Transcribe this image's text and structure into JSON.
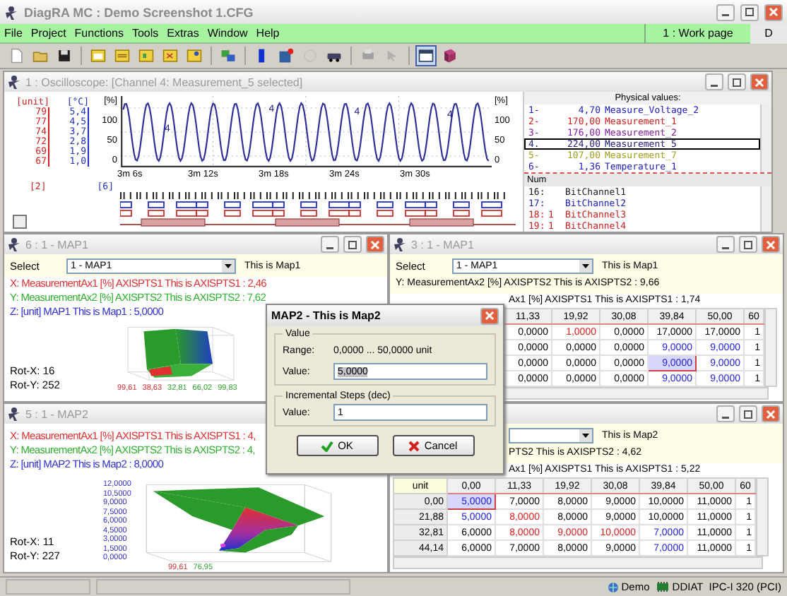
{
  "window": {
    "title": "DiagRA MC : Demo Screenshot 1.CFG"
  },
  "menu": [
    "File",
    "Project",
    "Functions",
    "Tools",
    "Extras",
    "Window",
    "Help"
  ],
  "work_page": "1 : Work page",
  "menu_right": "D",
  "oscilloscope": {
    "title": "1 : Oscilloscope: [Channel 4: Measurement_5 selected]",
    "axes": [
      {
        "unit": "[unit]",
        "ticks": [
          "79",
          "77",
          "74",
          "72",
          "69",
          "67"
        ],
        "index": "[2]",
        "color": "#d02020"
      },
      {
        "unit": "[°C]",
        "ticks": [
          "5,4",
          "4,5",
          "3,7",
          "2,8",
          "1,9",
          "1,0"
        ],
        "index": "[6]",
        "color": "#2030c0"
      }
    ],
    "left_percent": {
      "unit": "[%]",
      "ticks": [
        "100",
        "50",
        "0"
      ]
    },
    "right_percent": {
      "unit": "[%]",
      "ticks": [
        "100",
        "50",
        "0"
      ]
    },
    "wave_markers": [
      "4",
      "4",
      "4",
      "4"
    ],
    "time_ticks": [
      "3m 6s",
      "3m 12s",
      "3m 18s",
      "3m 24s",
      "3m 30s"
    ],
    "physical_header": "Physical values:",
    "physical_values": [
      {
        "num": "1-",
        "value": "4,70",
        "name": "Measure_Voltage_2",
        "color": "#2020c0",
        "selected": false
      },
      {
        "num": "2-",
        "value": "170,00",
        "name": "Measurement_1",
        "color": "#d02020",
        "selected": false
      },
      {
        "num": "3-",
        "value": "176,00",
        "name": "Measurement_2",
        "color": "#8020a0",
        "selected": false
      },
      {
        "num": "4.",
        "value": "224,00",
        "name": "Measurement_5",
        "color": "#202080",
        "selected": true
      },
      {
        "num": "5-",
        "value": "107,00",
        "name": "Measurement_7",
        "color": "#a0a020",
        "selected": false
      },
      {
        "num": "6-",
        "value": "1,36",
        "name": "Temperature_1",
        "color": "#2020c0",
        "selected": false
      }
    ],
    "num_header": "Num",
    "bit_channels": [
      {
        "num": "16:",
        "name": "BitChannel1",
        "color": "#202020"
      },
      {
        "num": "17:",
        "name": "BitChannel2",
        "color": "#2020c0"
      },
      {
        "num": "18:",
        "state": "1",
        "name": "BitChannel3",
        "color": "#d02020"
      },
      {
        "num": "19:",
        "state": "1",
        "name": "BitChannel4",
        "color": "#d02020"
      }
    ]
  },
  "map_views": [
    {
      "title": "6 : 1 - MAP1",
      "select": {
        "label": "Select",
        "value": "1 - MAP1",
        "description": "This is Map1"
      },
      "lines": [
        {
          "text": "X: MeasurementAx1 [%] AXISPTS1 This is AXISPTS1 : 2,46",
          "color": "#e03030"
        },
        {
          "text": "Y: MeasurementAx2 [%] AXISPTS2 This is AXISPTS2 : 7,62",
          "color": "#30b030"
        },
        {
          "text": "Z: [unit] MAP1 This is Map1 : 5,0000",
          "color": "#3030d0"
        }
      ],
      "kind": "steep",
      "x_labels": [
        "99,61",
        "38,63",
        "32,81",
        "66,02",
        "99,83"
      ],
      "rotation": [
        "Rot-X: 16",
        "Rot-Y: 252"
      ]
    },
    {
      "title": "5 : 1 - MAP2",
      "lines": [
        {
          "text": "X: MeasurementAx1 [%] AXISPTS1 This is AXISPTS1 : 4,",
          "color": "#e03030"
        },
        {
          "text": "Y: MeasurementAx2 [%] AXISPTS2 This is AXISPTS2 : 4,",
          "color": "#30b030"
        },
        {
          "text": "Z: [unit] MAP2 This is Map2 : 8,0000",
          "color": "#3030d0"
        }
      ],
      "kind": "slope",
      "z_labels": [
        "12,0000",
        "10,5000",
        "9,0000",
        "7,5000",
        "6,0000",
        "4,5000",
        "3,0000",
        "1,5000",
        "0,0000"
      ],
      "x_labels": [
        "99,61",
        "76,95"
      ],
      "rotation": [
        "Rot-X: 11",
        "Rot-Y: 227"
      ]
    }
  ],
  "map_tables": [
    {
      "title": "3 : 1 - MAP1",
      "select": {
        "label": "Select",
        "value": "1 - MAP1",
        "description": "This is Map1"
      },
      "lines": [
        "Y: MeasurementAx2 [%] AXISPTS2 This is AXISPTS2 : 9,66"
      ],
      "x_label": "Ax1 [%] AXISPTS1 This is AXISPTS1 : 1,74",
      "columns": [
        "11,33",
        "19,92",
        "30,08",
        "39,84",
        "50,00",
        "60"
      ],
      "rows": [
        {
          "cells": [
            {
              "t": "0,0000",
              "selected": false
            },
            {
              "t": "1,0000",
              "color": "#e02020",
              "selected": false
            },
            {
              "t": "0,0000",
              "selected": false
            },
            {
              "t": "17,0000",
              "selected": false
            },
            {
              "t": "17,0000",
              "selected": false
            },
            {
              "t": "1",
              "selected": false
            }
          ]
        },
        {
          "cells": [
            {
              "t": "0,0000",
              "selected": false
            },
            {
              "t": "0,0000",
              "selected": false
            },
            {
              "t": "0,0000",
              "selected": false
            },
            {
              "t": "9,0000",
              "color": "#2020e0",
              "selected": false
            },
            {
              "t": "9,0000",
              "color": "#2020e0",
              "selected": false
            },
            {
              "t": "1",
              "selected": false
            }
          ]
        },
        {
          "cells": [
            {
              "t": "0,0000",
              "selected": false
            },
            {
              "t": "0,0000",
              "selected": false
            },
            {
              "t": "0,0000",
              "selected": false
            },
            {
              "t": "9,0000",
              "color": "#2020e0",
              "selected": true
            },
            {
              "t": "9,0000",
              "color": "#2020e0",
              "selected": false
            },
            {
              "t": "1",
              "selected": false
            }
          ]
        },
        {
          "cells": [
            {
              "t": "0,0000",
              "selected": false
            },
            {
              "t": "0,0000",
              "selected": false
            },
            {
              "t": "0,0000",
              "selected": false
            },
            {
              "t": "9,0000",
              "color": "#2020e0",
              "selected": false
            },
            {
              "t": "9,0000",
              "color": "#2020e0",
              "selected": false
            },
            {
              "t": "1",
              "selected": false
            }
          ]
        }
      ]
    },
    {
      "select": {
        "description": "This is Map2"
      },
      "lines": [
        "PTS2 This is AXISPTS2 : 4,62"
      ],
      "x_label": "Ax1 [%] AXISPTS1 This is AXISPTS1 : 5,22",
      "corner": "unit",
      "columns": [
        "0,00",
        "11,33",
        "19,92",
        "30,08",
        "39,84",
        "50,00",
        "60"
      ],
      "rows": [
        {
          "header": "0,00",
          "cells": [
            {
              "t": "5,0000",
              "color": "#2020e0",
              "selected": true
            },
            {
              "t": "7,0000",
              "selected": false
            },
            {
              "t": "8,0000",
              "selected": false
            },
            {
              "t": "9,0000",
              "selected": false
            },
            {
              "t": "10,0000",
              "selected": false
            },
            {
              "t": "11,0000",
              "selected": false
            },
            {
              "t": "1",
              "selected": false
            }
          ]
        },
        {
          "header": "21,88",
          "cells": [
            {
              "t": "5,0000",
              "color": "#2020e0",
              "selected": false
            },
            {
              "t": "8,0000",
              "color": "#e02020",
              "selected": false
            },
            {
              "t": "8,0000",
              "selected": false
            },
            {
              "t": "9,0000",
              "selected": false
            },
            {
              "t": "10,0000",
              "selected": false
            },
            {
              "t": "11,0000",
              "selected": false
            },
            {
              "t": "1",
              "selected": false
            }
          ]
        },
        {
          "header": "32,81",
          "cells": [
            {
              "t": "6,0000",
              "selected": false
            },
            {
              "t": "8,0000",
              "color": "#e02020",
              "selected": false
            },
            {
              "t": "9,0000",
              "color": "#e02020",
              "selected": false
            },
            {
              "t": "10,0000",
              "color": "#e02020",
              "selected": false
            },
            {
              "t": "7,0000",
              "color": "#2020e0",
              "selected": false
            },
            {
              "t": "11,0000",
              "selected": false
            },
            {
              "t": "1",
              "selected": false
            }
          ]
        },
        {
          "header": "44,14",
          "cells": [
            {
              "t": "6,0000",
              "selected": false
            },
            {
              "t": "7,0000",
              "selected": false
            },
            {
              "t": "8,0000",
              "selected": false
            },
            {
              "t": "9,0000",
              "selected": false
            },
            {
              "t": "7,0000",
              "color": "#2020e0",
              "selected": false
            },
            {
              "t": "11,0000",
              "selected": false
            },
            {
              "t": "1",
              "selected": false
            }
          ]
        }
      ]
    }
  ],
  "dialog": {
    "title": "MAP2 - This is Map2",
    "groups": [
      {
        "title": "Value",
        "fields": [
          {
            "kind": "text",
            "label": "Range:",
            "text": "0,0000 ... 50,0000 unit"
          },
          {
            "kind": "input",
            "label": "Value:",
            "value": "5,0000",
            "selected": true
          }
        ]
      },
      {
        "title": "Incremental Steps (dec)",
        "fields": [
          {
            "kind": "input",
            "label": "Value:",
            "value": "1",
            "selected": false
          }
        ]
      }
    ],
    "buttons": [
      {
        "kind": "ok",
        "label": "OK"
      },
      {
        "kind": "cancel",
        "label": "Cancel"
      }
    ]
  },
  "status_bar": [
    {
      "kind": "globe",
      "text": "Demo"
    },
    {
      "kind": "chip",
      "text": "DDIAT"
    },
    {
      "kind": "plain",
      "text": "IPC-I 320 (PCI)"
    }
  ]
}
